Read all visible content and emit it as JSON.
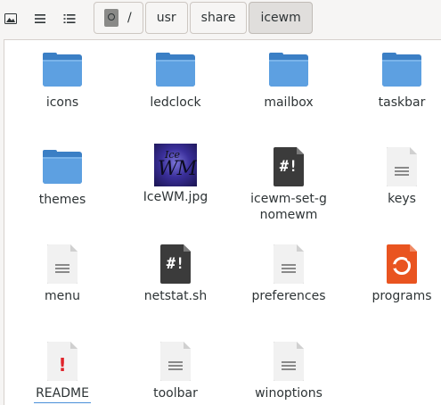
{
  "toolbar": {
    "left_icons": [
      "image-view-icon",
      "list-view-icon",
      "details-view-icon"
    ],
    "path": {
      "root_separator": "/",
      "crumbs": [
        "usr",
        "share",
        "icewm"
      ]
    }
  },
  "files": [
    {
      "name": "icons",
      "type": "folder"
    },
    {
      "name": "ledclock",
      "type": "folder"
    },
    {
      "name": "mailbox",
      "type": "folder"
    },
    {
      "name": "taskbar",
      "type": "folder"
    },
    {
      "name": "themes",
      "type": "folder"
    },
    {
      "name": "IceWM.jpg",
      "type": "image",
      "thumb_text": [
        "Ice",
        "WM"
      ]
    },
    {
      "name": "icewm-set-gnomewm",
      "type": "script"
    },
    {
      "name": "keys",
      "type": "text"
    },
    {
      "name": "menu",
      "type": "text"
    },
    {
      "name": "netstat.sh",
      "type": "script"
    },
    {
      "name": "preferences",
      "type": "text"
    },
    {
      "name": "programs",
      "type": "program"
    },
    {
      "name": "README",
      "type": "readme"
    },
    {
      "name": "toolbar",
      "type": "text"
    },
    {
      "name": "winoptions",
      "type": "text"
    }
  ],
  "colors": {
    "folder": "#5da0e1",
    "folder_dark": "#3b7fc5",
    "script_bg": "#3b3b3b",
    "program_bg": "#e95420",
    "readme_mark": "#e0242b",
    "selection_underline": "#4a90d9"
  }
}
